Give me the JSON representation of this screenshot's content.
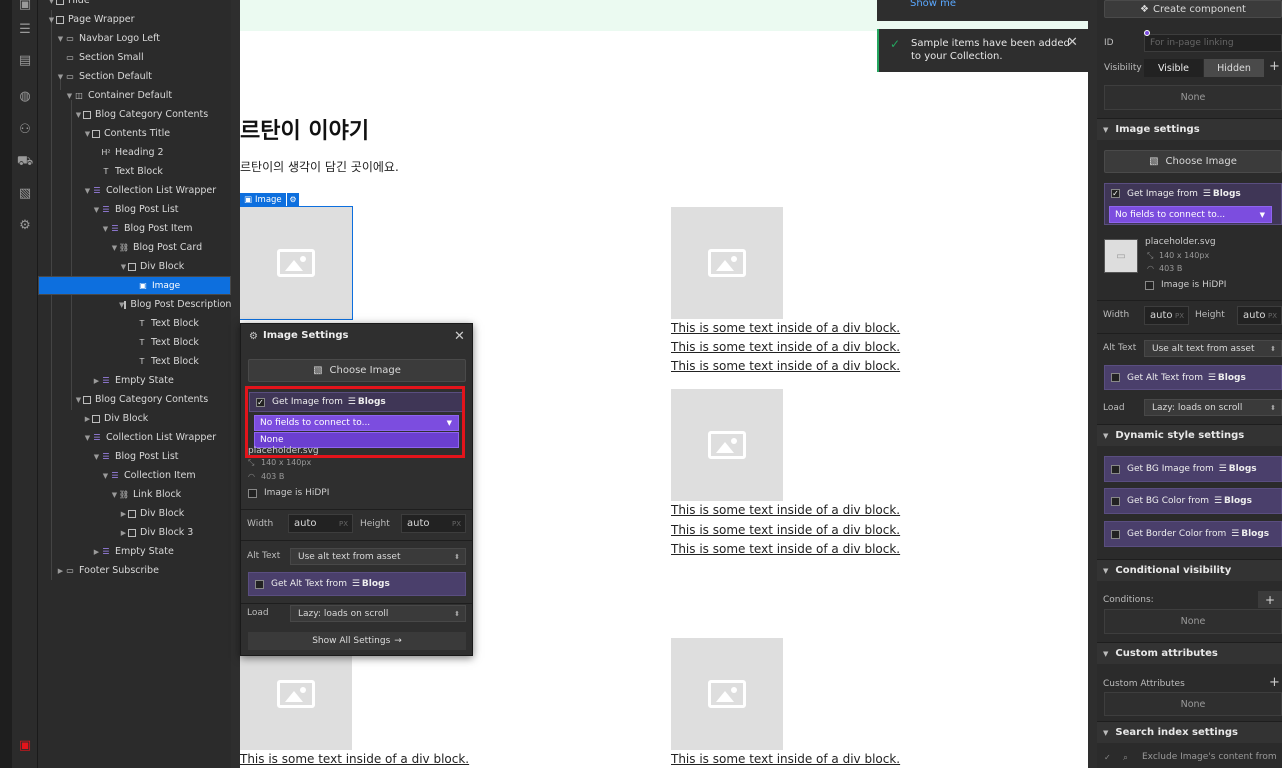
{
  "left_icons": [
    "layout-icon",
    "list-icon",
    "page-icon",
    "database-icon",
    "users-icon",
    "cart-icon",
    "assets-icon",
    "settings-icon"
  ],
  "navigator": [
    {
      "label": "Hide",
      "icon": "box"
    },
    {
      "label": "Page Wrapper",
      "icon": "box"
    },
    {
      "label": "Navbar Logo Left",
      "icon": "section"
    },
    {
      "label": "Section Small",
      "icon": "section"
    },
    {
      "label": "Section Default",
      "icon": "section"
    },
    {
      "label": "Container Default",
      "icon": "container"
    },
    {
      "label": "Blog Category Contents",
      "icon": "box"
    },
    {
      "label": "Contents Title",
      "icon": "box"
    },
    {
      "label": "Heading 2",
      "icon": "heading"
    },
    {
      "label": "Text Block",
      "icon": "text"
    },
    {
      "label": "Collection List Wrapper",
      "icon": "collection"
    },
    {
      "label": "Blog Post List",
      "icon": "collection"
    },
    {
      "label": "Blog Post Item",
      "icon": "collection"
    },
    {
      "label": "Blog Post Card",
      "icon": "link"
    },
    {
      "label": "Div Block",
      "icon": "box"
    },
    {
      "label": "Image",
      "icon": "image"
    },
    {
      "label": "Blog Post Description",
      "icon": "box"
    },
    {
      "label": "Text Block",
      "icon": "text"
    },
    {
      "label": "Text Block",
      "icon": "text"
    },
    {
      "label": "Text Block",
      "icon": "text"
    },
    {
      "label": "Empty State",
      "icon": "collection"
    },
    {
      "label": "Blog Category Contents",
      "icon": "box"
    },
    {
      "label": "Div Block",
      "icon": "box"
    },
    {
      "label": "Collection List Wrapper",
      "icon": "collection"
    },
    {
      "label": "Blog Post List",
      "icon": "collection"
    },
    {
      "label": "Collection Item",
      "icon": "collection"
    },
    {
      "label": "Link Block",
      "icon": "link"
    },
    {
      "label": "Div Block",
      "icon": "box"
    },
    {
      "label": "Div Block 3",
      "icon": "box"
    },
    {
      "label": "Empty State",
      "icon": "collection"
    },
    {
      "label": "Footer Subscribe",
      "icon": "section"
    }
  ],
  "canvas": {
    "heading": "르탄이 이야기",
    "subtext": "르탄이의 생각이 담긴 곳이에요.",
    "image_tag": "Image",
    "div_text": "This is some text inside of a div block."
  },
  "toast": {
    "show_me": "Show me",
    "message_line1": "Sample items have been added",
    "message_line2": "to your Collection."
  },
  "popup": {
    "title": "Image Settings",
    "choose_image": "Choose Image",
    "get_image_from": "Get Image from",
    "collection": "Blogs",
    "dropdown_value": "No fields to connect to...",
    "dropdown_option": "None",
    "file_name": "placeholder.svg",
    "dimensions": "140 x 140px",
    "file_size": "403 B",
    "hidpi": "Image is HiDPI",
    "width_label": "Width",
    "width_value": "auto",
    "height_label": "Height",
    "height_value": "auto",
    "unit": "PX",
    "alt_label": "Alt Text",
    "alt_value": "Use alt text from asset",
    "get_alt_from": "Get Alt Text from",
    "load_label": "Load",
    "load_value": "Lazy: loads on scroll",
    "show_all": "Show All Settings"
  },
  "right_panel": {
    "create_component": "Create component",
    "id_label": "ID",
    "id_placeholder": "For in-page linking",
    "visibility_label": "Visibility",
    "visible": "Visible",
    "hidden": "Hidden",
    "none": "None",
    "image_settings": "Image settings",
    "choose_image": "Choose Image",
    "get_image_from": "Get Image from",
    "collection": "Blogs",
    "dropdown_value": "No fields to connect to...",
    "file_name": "placeholder.svg",
    "dimensions": "140 x 140px",
    "file_size": "403 B",
    "hidpi": "Image is HiDPI",
    "width_label": "Width",
    "width_value": "auto",
    "height_label": "Height",
    "height_value": "auto",
    "unit": "PX",
    "alt_label": "Alt Text",
    "alt_value": "Use alt text from asset",
    "get_alt_from": "Get Alt Text from",
    "load_label": "Load",
    "load_value": "Lazy: loads on scroll",
    "dynamic_style": "Dynamic style settings",
    "get_bg_image": "Get BG Image from",
    "get_bg_color": "Get BG Color from",
    "get_border_color": "Get Border Color from",
    "conditional_visibility": "Conditional visibility",
    "conditions": "Conditions:",
    "custom_attributes": "Custom attributes",
    "custom_attributes_label": "Custom Attributes",
    "search_index": "Search index settings",
    "exclude_text": "Exclude Image's content from"
  },
  "colors": {
    "accent": "#0d6fde",
    "binding_purple": "#7c4ddf",
    "highlight_red": "#e3141b",
    "success_green": "#25a55f"
  }
}
